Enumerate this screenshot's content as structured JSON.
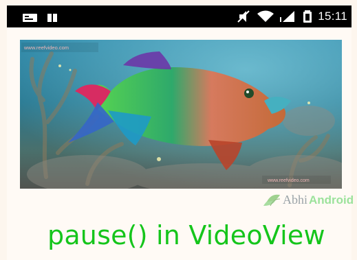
{
  "status_bar": {
    "time": "15:11",
    "icons": [
      "sim-card-icon",
      "grid-icon",
      "mute-icon",
      "wifi-icon",
      "signal-icon",
      "battery-icon"
    ]
  },
  "video": {
    "watermark_top": "www.reefvideo.com",
    "watermark_bottom": "www.reefvideo.com"
  },
  "branding": {
    "logo_part1": "Abhi",
    "logo_part2": "Android"
  },
  "caption": {
    "text": "pause() in VideoView"
  },
  "colors": {
    "caption": "#15c51b",
    "status_bar": "#000000",
    "background": "#fdf6ee"
  }
}
